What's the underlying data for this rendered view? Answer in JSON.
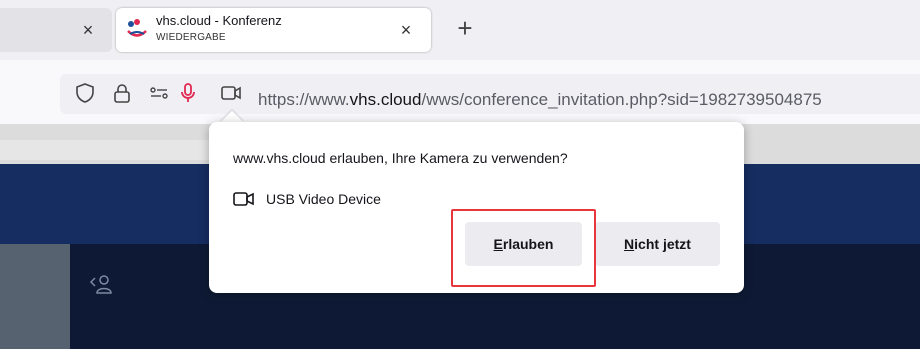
{
  "browser": {
    "tabs": [
      {
        "title": "",
        "close_label": "×"
      },
      {
        "title": "vhs.cloud - Konferenz",
        "subtitle": "WIEDERGABE",
        "close_label": "×"
      }
    ],
    "new_tab_label": "+",
    "url": {
      "prefix": "https://www.",
      "host": "vhs.cloud",
      "path": "/wws/conference_invitation.php?sid=1982739504875"
    }
  },
  "permission_popup": {
    "title": "www.vhs.cloud erlauben, Ihre Kamera zu verwenden?",
    "device_label": "USB Video Device",
    "allow_button": {
      "hotkey": "E",
      "rest": "rlauben"
    },
    "deny_button": {
      "hotkey": "N",
      "rest": "icht jetzt"
    }
  },
  "colors": {
    "header_blue": "#162d61",
    "highlight_red": "#e8363f",
    "mic_red": "#e22850"
  }
}
